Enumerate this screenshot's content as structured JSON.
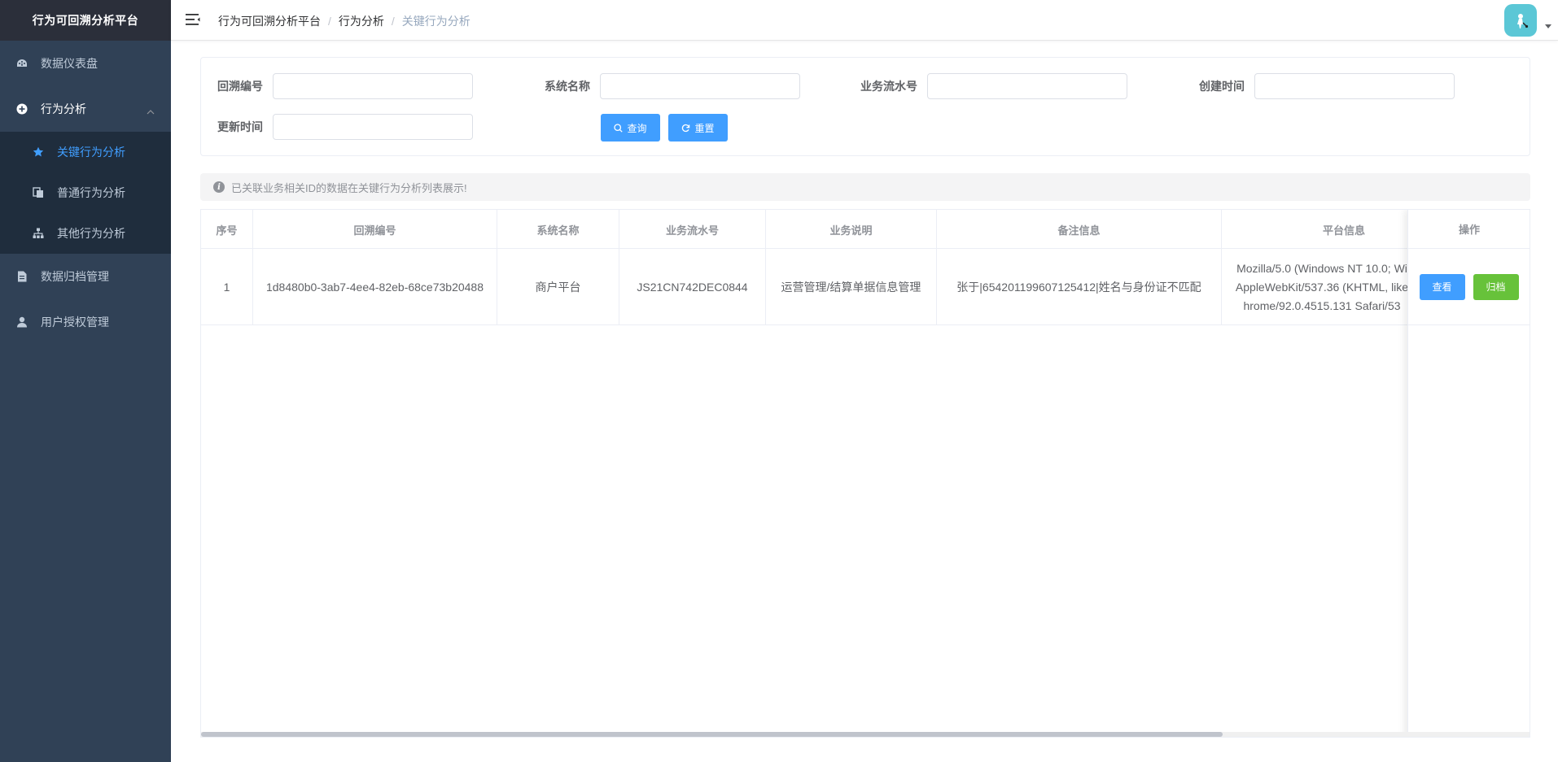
{
  "sidebar": {
    "title": "行为可回溯分析平台",
    "items": [
      {
        "label": "数据仪表盘",
        "icon": "dashboard-icon"
      },
      {
        "label": "行为分析",
        "icon": "plus-circle-icon",
        "expanded": true,
        "children": [
          {
            "label": "关键行为分析",
            "icon": "star-icon",
            "active": true
          },
          {
            "label": "普通行为分析",
            "icon": "copy-icon"
          },
          {
            "label": "其他行为分析",
            "icon": "tree-icon"
          }
        ]
      },
      {
        "label": "数据归档管理",
        "icon": "document-icon"
      },
      {
        "label": "用户授权管理",
        "icon": "user-icon"
      }
    ]
  },
  "navbar": {
    "breadcrumb": [
      "行为可回溯分析平台",
      "行为分析",
      "关键行为分析"
    ],
    "separator": "/"
  },
  "search": {
    "fields": [
      {
        "label": "回溯编号",
        "value": ""
      },
      {
        "label": "系统名称",
        "value": ""
      },
      {
        "label": "业务流水号",
        "value": ""
      },
      {
        "label": "创建时间",
        "value": ""
      },
      {
        "label": "更新时间",
        "value": ""
      }
    ],
    "query_label": "查询",
    "reset_label": "重置"
  },
  "alert": {
    "text": "已关联业务相关ID的数据在关键行为分析列表展示!"
  },
  "table": {
    "columns": [
      "序号",
      "回溯编号",
      "系统名称",
      "业务流水号",
      "业务说明",
      "备注信息",
      "平台信息",
      "操作"
    ],
    "rows": [
      {
        "index": "1",
        "trace_id": "1d8480b0-3ab7-4ee4-82eb-68ce73b20488",
        "system": "商户平台",
        "serial": "JS21CN742DEC0844",
        "business": "运营管理/结算单据信息管理",
        "remark": "张于|654201199607125412|姓名与身份证不匹配",
        "platform_lines": [
          "Mozilla/5.0 (Windows NT 10.0; Wi",
          "AppleWebKit/537.36 (KHTML, like",
          "hrome/92.0.4515.131 Safari/53"
        ]
      }
    ],
    "ops": {
      "view_label": "查看",
      "archive_label": "归档"
    }
  },
  "colors": {
    "sidebar_bg": "#304156",
    "sidebar_title_bg": "#2b2f3a",
    "submenu_bg": "#1f2d3d",
    "primary": "#409eff",
    "success": "#67c23a",
    "avatar_bg": "#5bc7d6"
  }
}
